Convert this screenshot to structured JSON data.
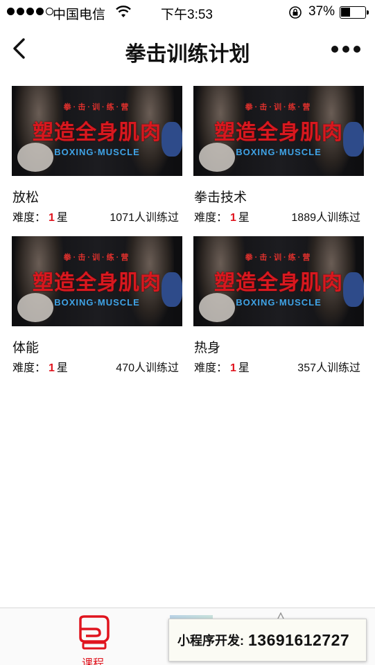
{
  "status_bar": {
    "carrier": "中国电信",
    "time": "下午3:53",
    "battery": "37%"
  },
  "nav": {
    "title": "拳击训练计划"
  },
  "banner": {
    "camp": "拳·击·训·练·营",
    "headline": "塑造全身肌肉",
    "subline": "BOXING·MUSCLE"
  },
  "courses": [
    {
      "name": "放松",
      "difficulty_label": "难度：",
      "stars": "1",
      "star_unit": "星",
      "trained": "1071人训练过"
    },
    {
      "name": "拳击技术",
      "difficulty_label": "难度：",
      "stars": "1",
      "star_unit": "星",
      "trained": "1889人训练过"
    },
    {
      "name": "体能",
      "difficulty_label": "难度：",
      "stars": "1",
      "star_unit": "星",
      "trained": "470人训练过"
    },
    {
      "name": "热身",
      "difficulty_label": "难度：",
      "stars": "1",
      "star_unit": "星",
      "trained": "357人训练过"
    }
  ],
  "tab_bar": {
    "course_label": "课程"
  },
  "promo": {
    "label": "小程序开发:",
    "phone": "13691612727"
  },
  "colors": {
    "accent": "#e0141e",
    "headline_red": "#d8181f",
    "subline_blue": "#3fa3e6"
  }
}
